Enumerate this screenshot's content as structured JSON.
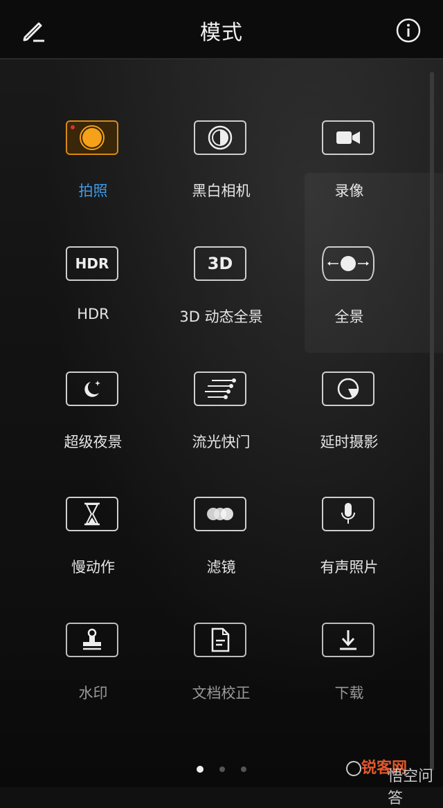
{
  "header": {
    "title": "模式"
  },
  "colors": {
    "accent_active_label": "#3f9be8",
    "accent_active_icon": "#f5a11a",
    "icon_border": "#cfcfcf"
  },
  "modes": [
    {
      "label": "拍照",
      "icon": "photo-icon",
      "active": true
    },
    {
      "label": "黑白相机",
      "icon": "monochrome-icon"
    },
    {
      "label": "录像",
      "icon": "video-camera-icon"
    },
    {
      "label": "HDR",
      "icon": "hdr-icon",
      "icon_text": "HDR"
    },
    {
      "label": "3D 动态全景",
      "icon": "3d-panorama-icon",
      "icon_text": "3D"
    },
    {
      "label": "全景",
      "icon": "panorama-icon"
    },
    {
      "label": "超级夜景",
      "icon": "night-icon"
    },
    {
      "label": "流光快门",
      "icon": "light-painting-icon"
    },
    {
      "label": "延时摄影",
      "icon": "time-lapse-icon"
    },
    {
      "label": "慢动作",
      "icon": "hourglass-icon"
    },
    {
      "label": "滤镜",
      "icon": "filter-icon"
    },
    {
      "label": "有声照片",
      "icon": "microphone-icon"
    },
    {
      "label": "水印",
      "icon": "stamp-icon"
    },
    {
      "label": "文档校正",
      "icon": "document-icon"
    },
    {
      "label": "下载",
      "icon": "download-icon"
    }
  ],
  "pagination": {
    "current": 1,
    "total": 3
  },
  "watermark": {
    "brand": "锐客网",
    "sub": "悟空问答"
  }
}
